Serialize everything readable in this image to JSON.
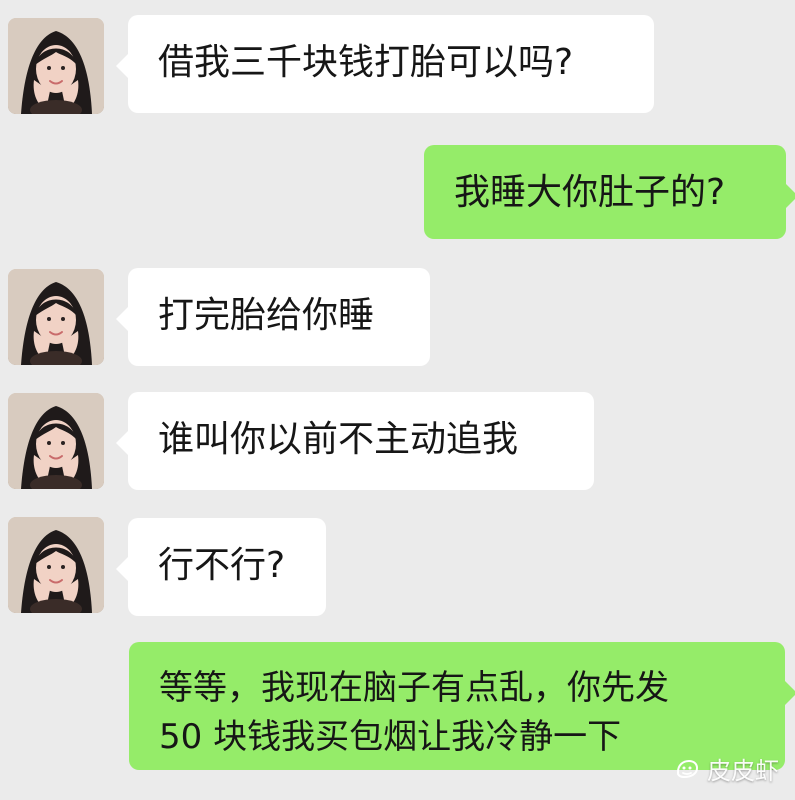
{
  "conversation": {
    "messages": [
      {
        "side": "left",
        "text": "借我三千块钱打胎可以吗?"
      },
      {
        "side": "right",
        "text": "我睡大你肚子的?"
      },
      {
        "side": "left",
        "text": "打完胎给你睡"
      },
      {
        "side": "left",
        "text": "谁叫你以前不主动追我"
      },
      {
        "side": "left",
        "text": "行不行?"
      },
      {
        "side": "right",
        "line1": "等等，我现在脑子有点乱，你先发",
        "line2": "50 块钱我买包烟让我冷静一下"
      }
    ]
  },
  "colors": {
    "background": "#ebebeb",
    "left_bubble": "#ffffff",
    "right_bubble": "#95ec69",
    "text": "#161616"
  },
  "icons": {
    "avatar": "avatar-image",
    "watermark_logo": "pipixia-logo-icon"
  },
  "watermark": {
    "text": "皮皮虾"
  }
}
